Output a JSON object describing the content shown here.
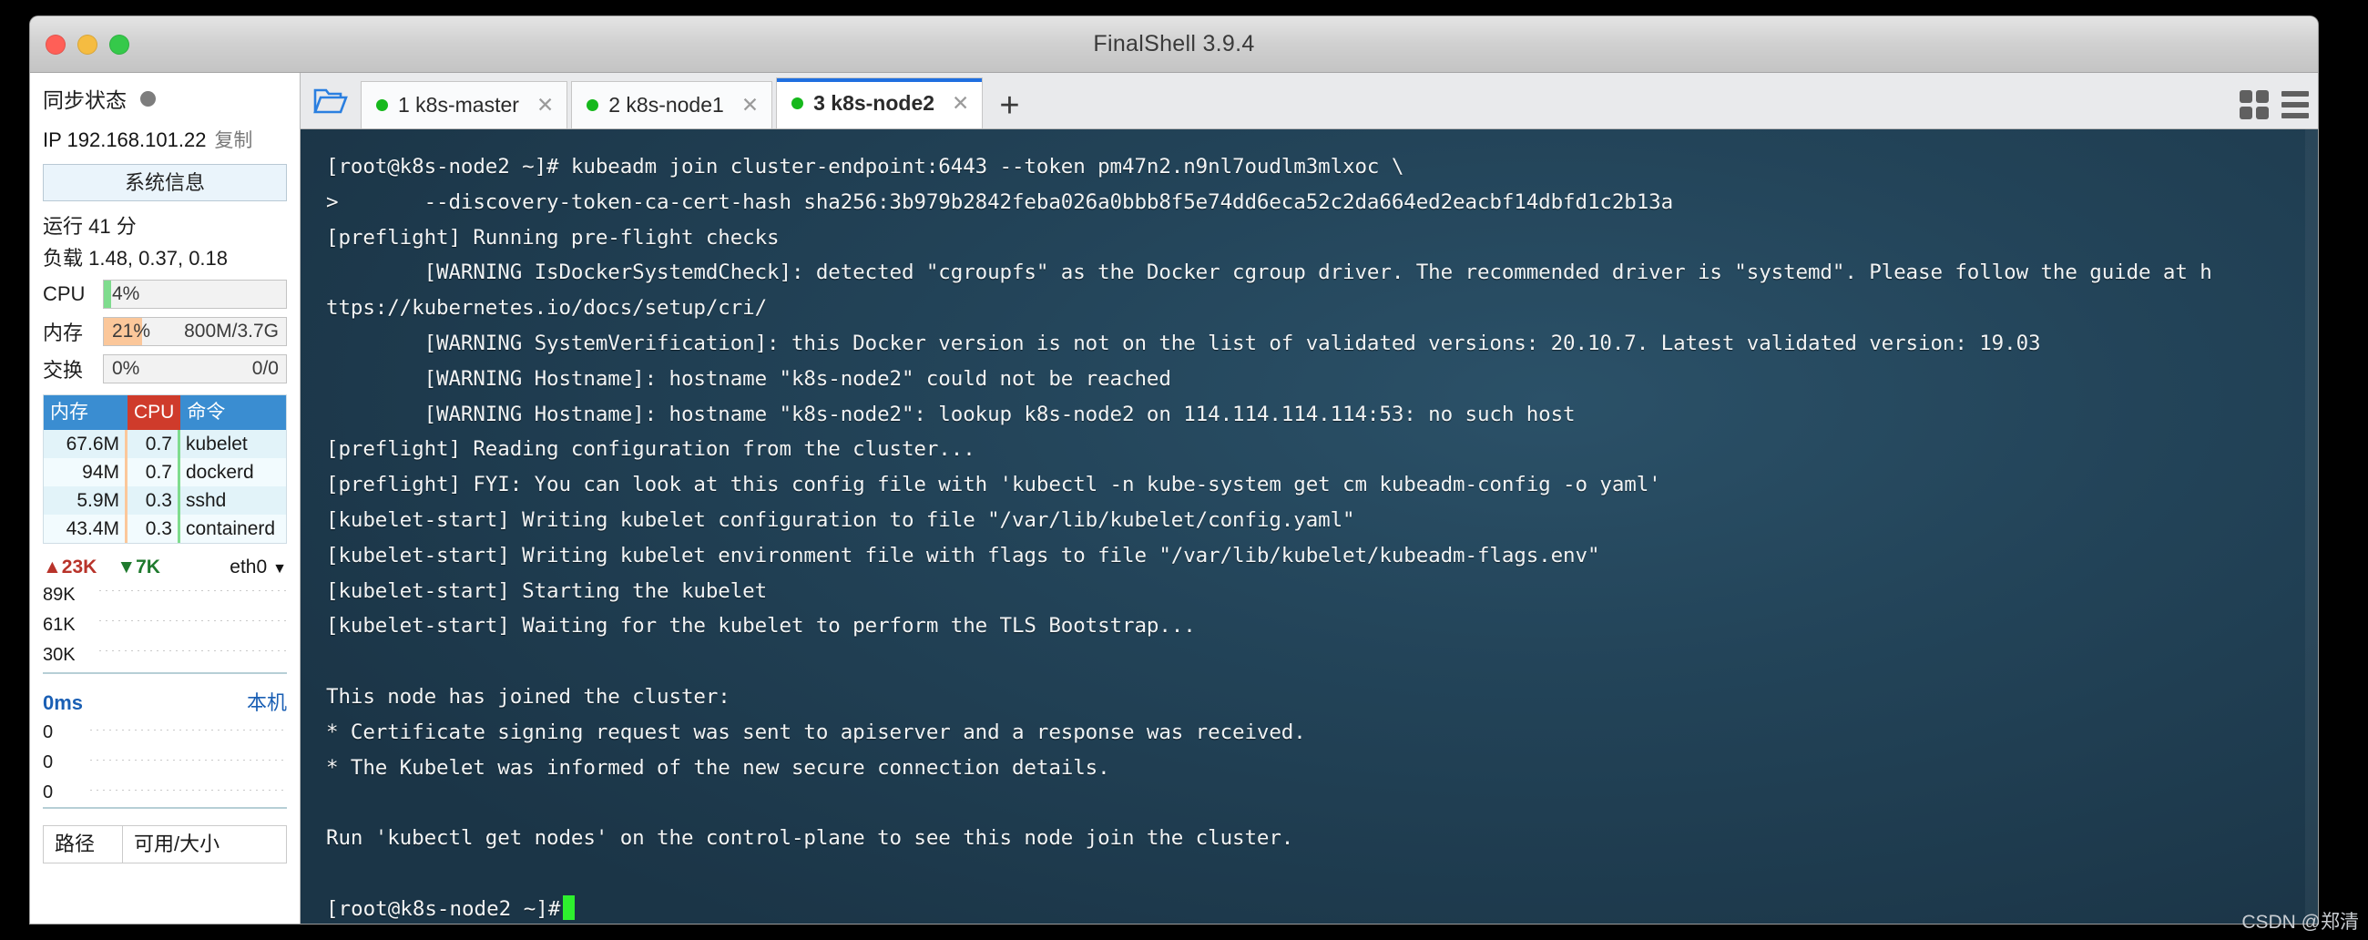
{
  "window": {
    "title": "FinalShell 3.9.4",
    "traffic_lights": [
      "close",
      "minimize",
      "maximize"
    ]
  },
  "sidebar": {
    "sync_status_label": "同步状态",
    "ip_label": "IP 192.168.101.22",
    "copy_label": "复制",
    "system_info_button": "系统信息",
    "uptime": "运行 41 分",
    "loadavg": "负载 1.48, 0.37, 0.18",
    "meters": [
      {
        "name": "CPU",
        "percent_text": "4%",
        "percent": 4,
        "sub": "",
        "color": "#7fdc8e"
      },
      {
        "name": "内存",
        "percent_text": "21%",
        "percent": 21,
        "sub": "800M/3.7G",
        "color": "#fbc79a"
      },
      {
        "name": "交换",
        "percent_text": "0%",
        "percent": 0,
        "sub": "0/0",
        "color": "#cccccc"
      }
    ],
    "process_table": {
      "headers": [
        "内存",
        "CPU",
        "命令"
      ],
      "rows": [
        {
          "mem": "67.6M",
          "cpu": "0.7",
          "cmd": "kubelet"
        },
        {
          "mem": "94M",
          "cpu": "0.7",
          "cmd": "dockerd"
        },
        {
          "mem": "5.9M",
          "cpu": "0.3",
          "cmd": "sshd"
        },
        {
          "mem": "43.4M",
          "cpu": "0.3",
          "cmd": "containerd"
        }
      ]
    },
    "network": {
      "upload": "23K",
      "download": "7K",
      "interface": "eth0",
      "y_labels": [
        "89K",
        "61K",
        "30K"
      ]
    },
    "latency": {
      "value": "0ms",
      "target": "本机",
      "y_labels": [
        "0",
        "0",
        "0"
      ]
    },
    "disk_header": {
      "path": "路径",
      "size": "可用/大小"
    }
  },
  "tabs": [
    {
      "index": "1",
      "label": "1 k8s-master",
      "active": false,
      "status": "connected"
    },
    {
      "index": "2",
      "label": "2 k8s-node1",
      "active": false,
      "status": "connected"
    },
    {
      "index": "3",
      "label": "3 k8s-node2",
      "active": true,
      "status": "connected"
    }
  ],
  "tab_add_label": "+",
  "terminal": {
    "lines": [
      "[root@k8s-node2 ~]# kubeadm join cluster-endpoint:6443 --token pm47n2.n9nl7oudlm3mlxoc \\",
      ">       --discovery-token-ca-cert-hash sha256:3b979b2842feba026a0bbb8f5e74dd6eca52c2da664ed2eacbf14dbfd1c2b13a",
      "[preflight] Running pre-flight checks",
      "        [WARNING IsDockerSystemdCheck]: detected \"cgroupfs\" as the Docker cgroup driver. The recommended driver is \"systemd\". Please follow the guide at h",
      "ttps://kubernetes.io/docs/setup/cri/",
      "        [WARNING SystemVerification]: this Docker version is not on the list of validated versions: 20.10.7. Latest validated version: 19.03",
      "        [WARNING Hostname]: hostname \"k8s-node2\" could not be reached",
      "        [WARNING Hostname]: hostname \"k8s-node2\": lookup k8s-node2 on 114.114.114.114:53: no such host",
      "[preflight] Reading configuration from the cluster...",
      "[preflight] FYI: You can look at this config file with 'kubectl -n kube-system get cm kubeadm-config -o yaml'",
      "[kubelet-start] Writing kubelet configuration to file \"/var/lib/kubelet/config.yaml\"",
      "[kubelet-start] Writing kubelet environment file with flags to file \"/var/lib/kubelet/kubeadm-flags.env\"",
      "[kubelet-start] Starting the kubelet",
      "[kubelet-start] Waiting for the kubelet to perform the TLS Bootstrap...",
      "",
      "This node has joined the cluster:",
      "* Certificate signing request was sent to apiserver and a response was received.",
      "* The Kubelet was informed of the new secure connection details.",
      "",
      "Run 'kubectl get nodes' on the control-plane to see this node join the cluster.",
      ""
    ],
    "prompt": "[root@k8s-node2 ~]#",
    "cursor_color": "#2ef02e"
  },
  "watermark": "CSDN @郑清",
  "colors": {
    "accent_blue": "#1f6fe0",
    "terminal_bg": "#234459",
    "status_green": "#16b81c",
    "table_header_blue": "#3a8dd1",
    "table_header_red": "#cf3b2b"
  }
}
